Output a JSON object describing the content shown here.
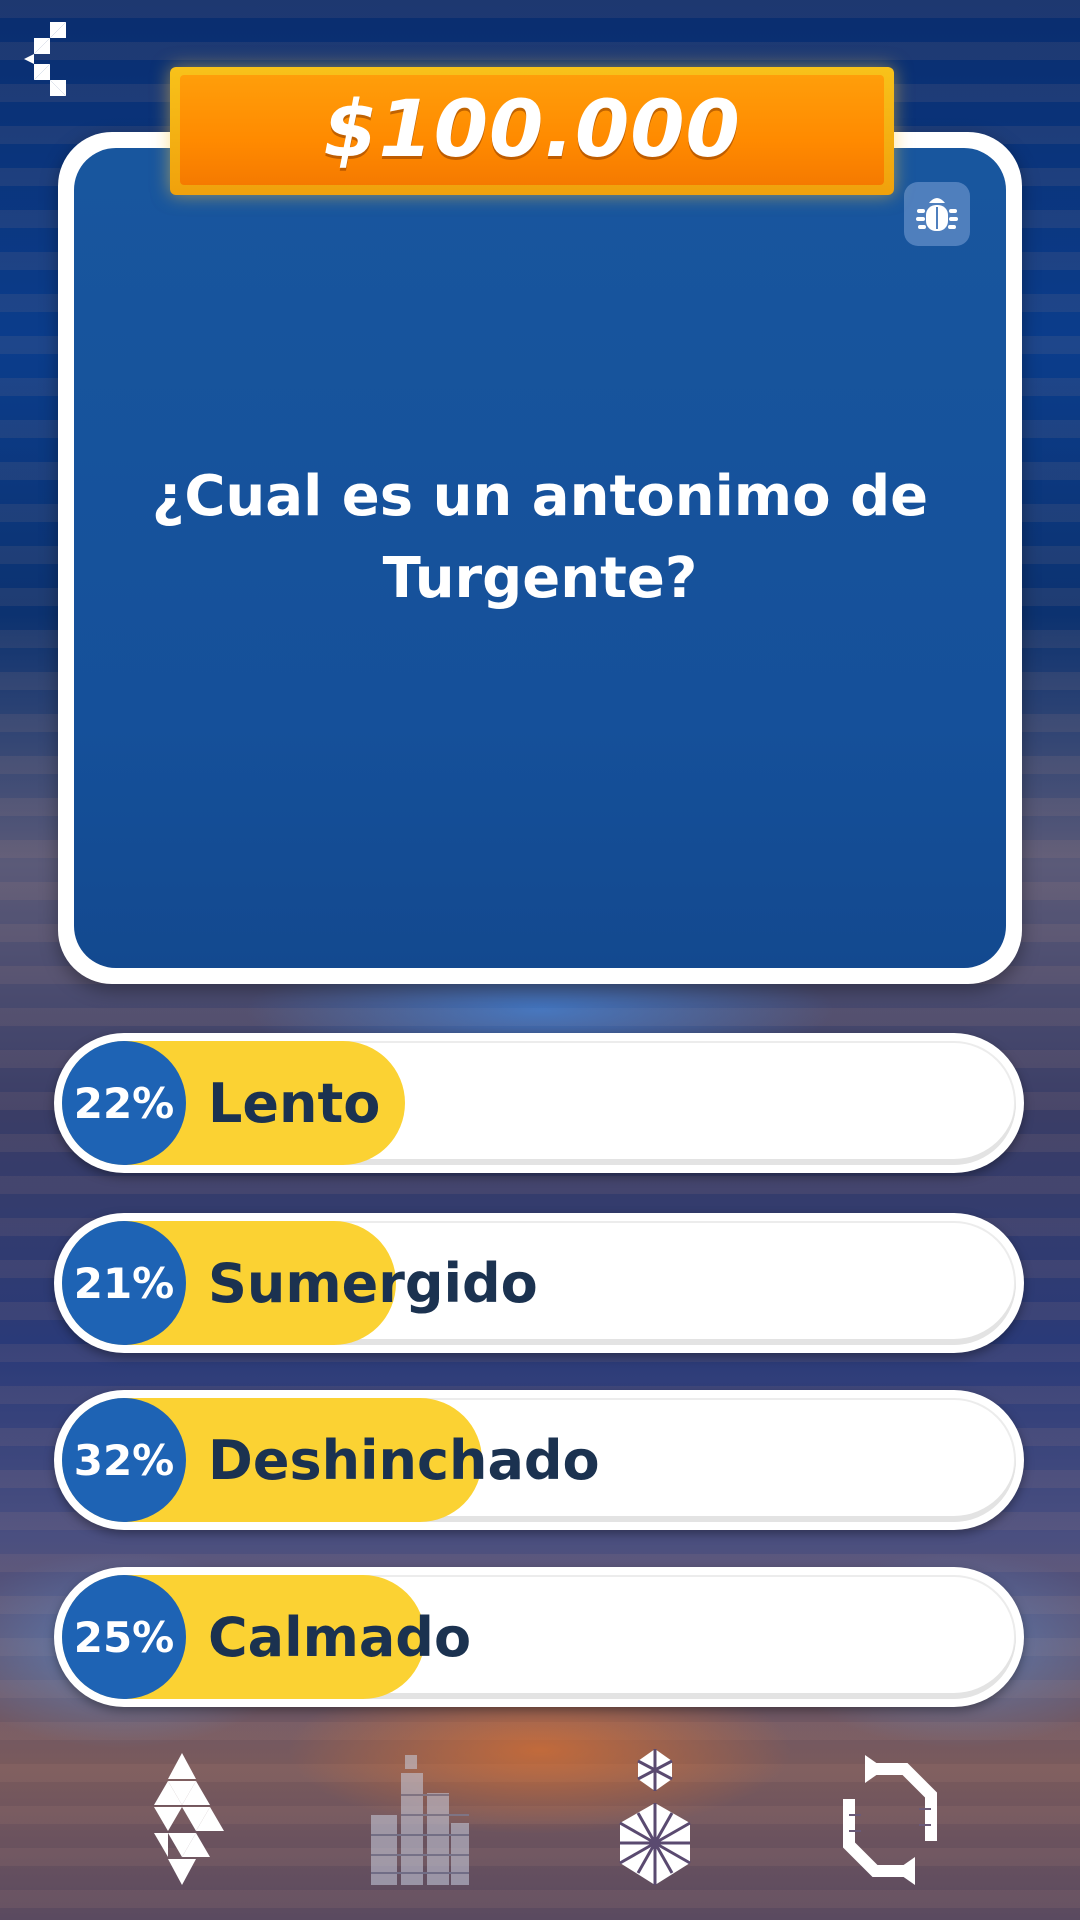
{
  "header": {
    "back_icon": "chevron-left-triangles-icon"
  },
  "prize": {
    "amount": "$100.000",
    "colors": {
      "outer": "#f8c21a",
      "inner": "#ff8a00"
    }
  },
  "question": {
    "text": "¿Cual es un antonimo de Turgente?",
    "bug_icon": "bug-icon",
    "colors": {
      "card": "#15509a",
      "border": "#ffffff"
    }
  },
  "answers": [
    {
      "percent_label": "22%",
      "percent": 22,
      "label": "Lento",
      "fill_fraction": 0.36
    },
    {
      "percent_label": "21%",
      "percent": 21,
      "label": "Sumergido",
      "fill_fraction": 0.35
    },
    {
      "percent_label": "32%",
      "percent": 32,
      "label": "Deshinchado",
      "fill_fraction": 0.44
    },
    {
      "percent_label": "25%",
      "percent": 25,
      "label": "Calmado",
      "fill_fraction": 0.38
    }
  ],
  "answer_colors": {
    "badge": "#1e63b4",
    "fill": "#fbd233",
    "text": "#1b3250"
  },
  "lifelines": [
    {
      "icon": "fifty-fifty-lifeline-icon",
      "used": false
    },
    {
      "icon": "audience-poll-lifeline-icon",
      "used": true
    },
    {
      "icon": "phone-friend-lifeline-icon",
      "used": false
    },
    {
      "icon": "switch-question-lifeline-icon",
      "used": false
    }
  ]
}
